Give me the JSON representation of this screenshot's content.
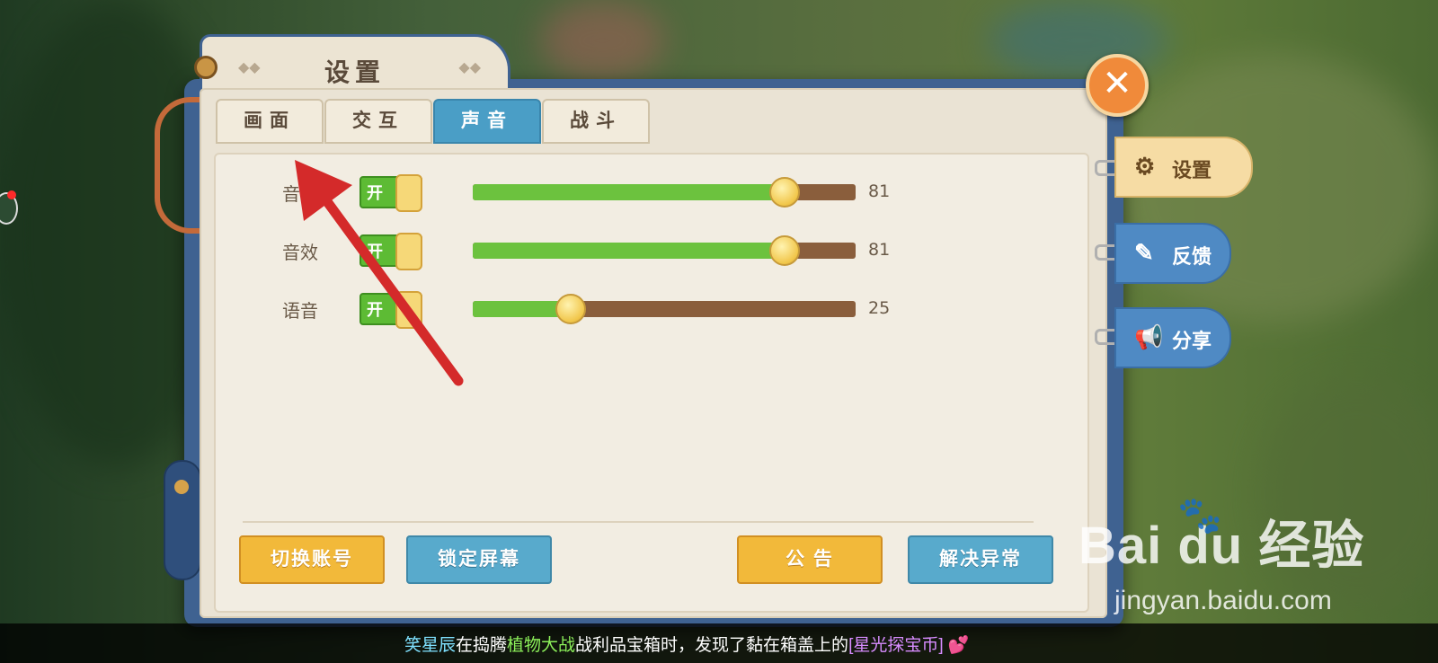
{
  "window": {
    "title": "设置"
  },
  "tabs": [
    {
      "label": "画面",
      "active": false
    },
    {
      "label": "交互",
      "active": false
    },
    {
      "label": "声音",
      "active": true
    },
    {
      "label": "战斗",
      "active": false
    }
  ],
  "sound_rows": [
    {
      "label": "音乐",
      "toggle_label": "开",
      "toggle_on": true,
      "value": 81,
      "value_text": "81"
    },
    {
      "label": "音效",
      "toggle_label": "开",
      "toggle_on": true,
      "value": 81,
      "value_text": "81"
    },
    {
      "label": "语音",
      "toggle_label": "开",
      "toggle_on": true,
      "value": 25,
      "value_text": "25"
    }
  ],
  "bottom_buttons": {
    "switch_account": "切换账号",
    "lock_screen": "锁定屏幕",
    "announcement": "公 告",
    "fix_issue": "解决异常"
  },
  "side_tabs": {
    "settings": {
      "label": "设置",
      "icon": "gear-icon"
    },
    "feedback": {
      "label": "反馈",
      "icon": "edit-icon"
    },
    "share": {
      "label": "分享",
      "icon": "megaphone-icon"
    }
  },
  "close": {
    "icon": "close-icon",
    "glyph": "✕"
  },
  "ticker": {
    "name": "笑星辰",
    "text1": "在捣腾",
    "event": "植物大战",
    "text2": "战利品宝箱时，发现了黏在箱盖上的",
    "item": "[星光探宝币]"
  },
  "watermark": {
    "brand": "Bai du 经验",
    "site": "jingyan.baidu.com"
  },
  "colors": {
    "accent_blue": "#4a9ec6",
    "toggle_green": "#5dbb34",
    "slider_fill": "#6cc23e",
    "slider_track": "#8a5e3c",
    "button_orange": "#f2b93a",
    "button_blue": "#58aacc",
    "annotation_arrow": "#d42a2a"
  }
}
